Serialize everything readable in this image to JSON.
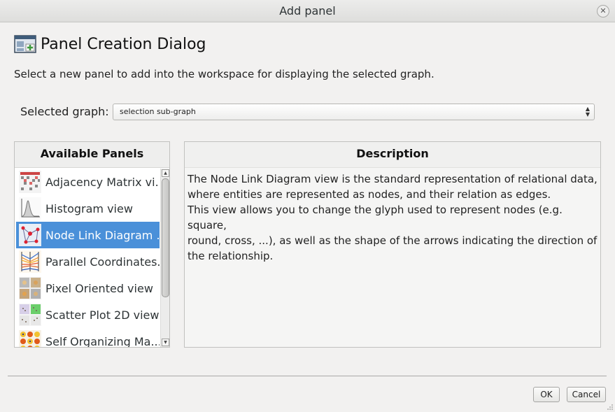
{
  "window": {
    "title": "Add panel"
  },
  "header": {
    "title": "Panel Creation Dialog"
  },
  "subtitle": "Select a new panel to add into the workspace for displaying the selected graph.",
  "graph_selector": {
    "label": "Selected graph:",
    "value": "selection sub-graph"
  },
  "panels": {
    "header": "Available Panels",
    "items": [
      {
        "label": "Adjacency Matrix vi...",
        "icon": "adjacency-matrix-icon",
        "selected": false
      },
      {
        "label": "Histogram view",
        "icon": "histogram-icon",
        "selected": false
      },
      {
        "label": "Node Link Diagram ...",
        "icon": "node-link-diagram-icon",
        "selected": true
      },
      {
        "label": "Parallel Coordinates...",
        "icon": "parallel-coordinates-icon",
        "selected": false
      },
      {
        "label": "Pixel Oriented view",
        "icon": "pixel-oriented-icon",
        "selected": false
      },
      {
        "label": "Scatter Plot 2D view",
        "icon": "scatter-plot-icon",
        "selected": false
      },
      {
        "label": "Self Organizing Ma...",
        "icon": "self-organizing-map-icon",
        "selected": false
      }
    ]
  },
  "description": {
    "header": "Description",
    "lines": [
      "The Node Link Diagram view is the standard representation of relational data,",
      "where entities are represented as nodes, and their relation as edges.",
      "This view allows you to change the glyph used to represent nodes (e.g. square,",
      "round, cross, ...), as well as the shape of the arrows indicating the direction of",
      "the relationship."
    ]
  },
  "buttons": {
    "ok": "OK",
    "cancel": "Cancel"
  },
  "colors": {
    "selection": "#4a90d9",
    "background": "#f2f1f0"
  }
}
